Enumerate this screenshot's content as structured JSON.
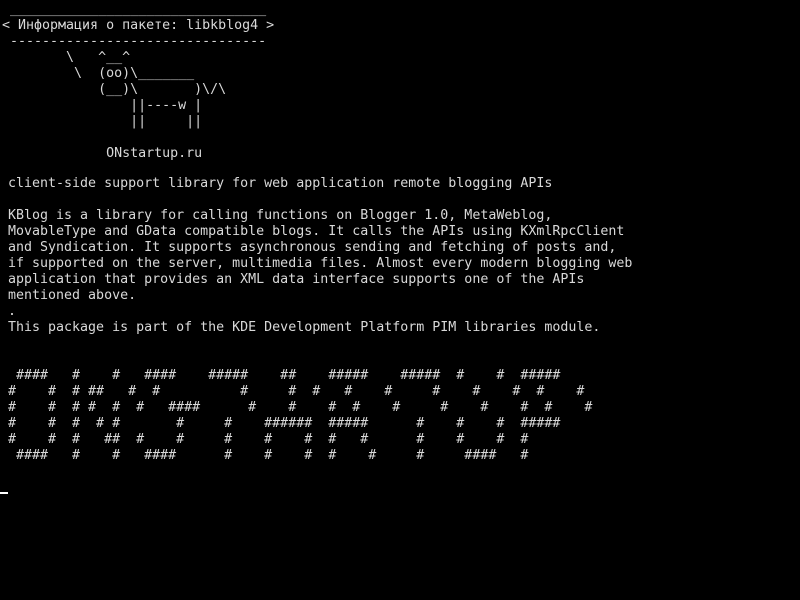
{
  "colors": {
    "background": "#000000",
    "text": "#d9d9d9",
    "cursor": "#ffffff"
  },
  "terminal": {
    "cowsay": " ________________________________\n< Информация о пакете: libkblog4 >\n --------------------------------\n        \\   ^__^\n         \\  (oo)\\_______\n            (__)\\       )\\/\\\n                ||----w |\n                ||     ||\n\n             ONstartup.ru",
    "summary": "client-side support library for web application remote blogging APIs",
    "description": "KBlog is a library for calling functions on Blogger 1.0, MetaWeblog,\nMovableType and GData compatible blogs. It calls the APIs using KXmlRpcClient\nand Syndication. It supports asynchronous sending and fetching of posts and,\nif supported on the server, multimedia files. Almost every modern blogging web\napplication that provides an XML data interface supports one of the APIs\nmentioned above.\n.\nThis package is part of the KDE Development Platform PIM libraries module.",
    "banner": " ####   #    #   ####    #####    ##    #####    #####  #    #  #####\n#    #  # ##   #  #          #     #  #   #    #     #    #    #  #    #\n#    #  # #  #  #   ####      #    #    #  #    #     #    #    #  #    #\n#    #  #  # #       #     #    ######  #####      #    #    #  #####\n#    #  #   ##  #    #     #    #    #  #   #      #    #    #  #\n ####   #    #   ####      #    #    #  #    #     #     ####   #"
  }
}
